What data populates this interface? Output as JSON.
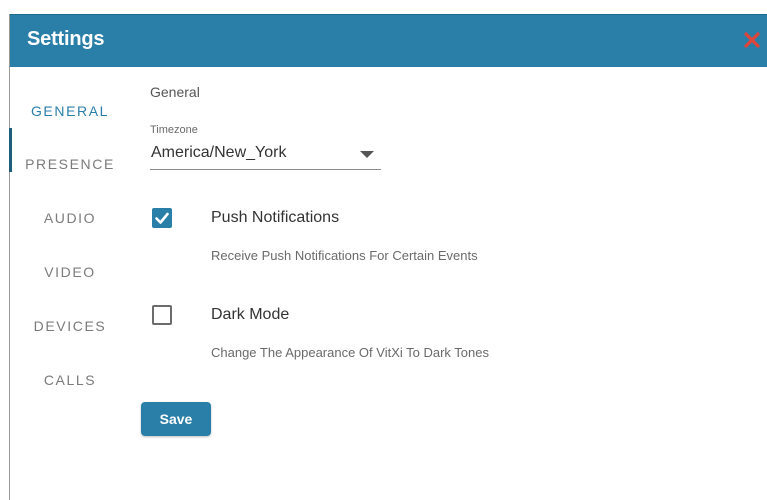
{
  "dialog": {
    "title": "Settings",
    "close_icon": "close-icon",
    "close_color": "#e0453b",
    "accent": "#2a7fa8"
  },
  "sidebar": {
    "items": [
      {
        "label": "GENERAL",
        "active": true
      },
      {
        "label": "PRESENCE",
        "active": false
      },
      {
        "label": "AUDIO",
        "active": false
      },
      {
        "label": "VIDEO",
        "active": false
      },
      {
        "label": "DEVICES",
        "active": false
      },
      {
        "label": "CALLS",
        "active": false
      }
    ]
  },
  "general": {
    "section_title": "General",
    "timezone": {
      "label": "Timezone",
      "value": "America/New_York"
    },
    "push_notifications": {
      "title": "Push Notifications",
      "description": "Receive Push Notifications For Certain Events",
      "checked": true
    },
    "dark_mode": {
      "title": "Dark Mode",
      "description": "Change The Appearance Of VitXi To Dark Tones",
      "checked": false
    },
    "save_label": "Save"
  }
}
